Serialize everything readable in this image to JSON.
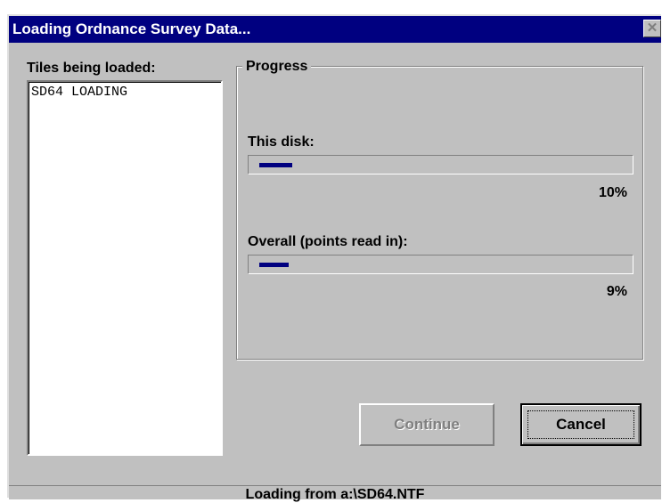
{
  "window": {
    "title": "Loading Ordnance Survey Data...",
    "close_glyph": "✕"
  },
  "tiles": {
    "label": "Tiles being loaded:",
    "items": [
      "SD64 LOADING"
    ]
  },
  "progress": {
    "group_label": "Progress",
    "disk": {
      "label": "This disk:",
      "percent_text": "10%",
      "fraction": 0.1
    },
    "overall": {
      "label": "Overall (points read in):",
      "percent_text": "9%",
      "fraction": 0.09
    }
  },
  "buttons": {
    "continue_label": "Continue",
    "continue_enabled": false,
    "cancel_label": "Cancel"
  },
  "status": {
    "text": "Loading from a:\\SD64.NTF"
  },
  "colors": {
    "title_bg": "#000080",
    "dialog_bg": "#c0c0c0",
    "progress_fill": "#000080"
  }
}
